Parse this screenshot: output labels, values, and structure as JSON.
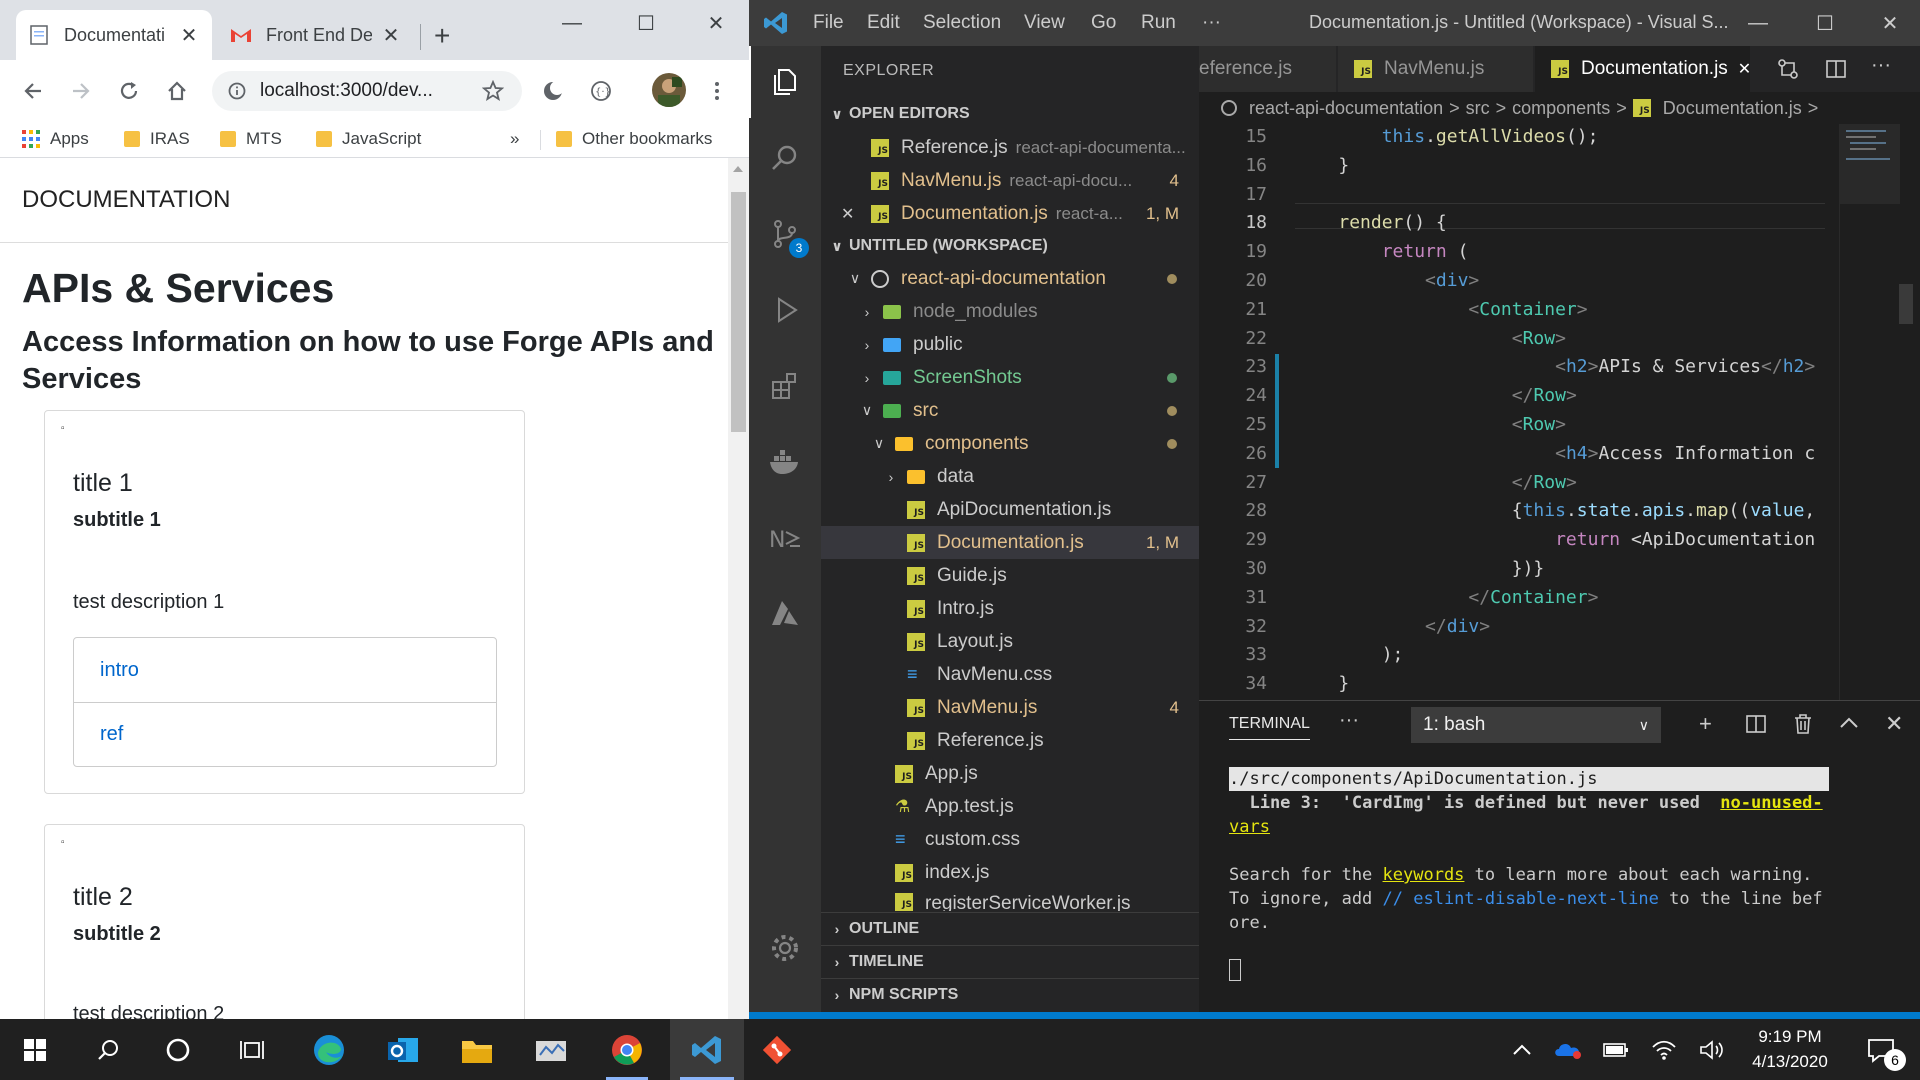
{
  "chrome": {
    "tabs": [
      {
        "title": "Documentati",
        "active": true
      },
      {
        "title": "Front End De",
        "active": false
      }
    ],
    "url": "localhost:3000/dev...",
    "bookmarks": [
      "Apps",
      "IRAS",
      "MTS",
      "JavaScript"
    ],
    "other_bookmarks": "Other bookmarks",
    "overflow": "»"
  },
  "page": {
    "navbar_title": "DOCUMENTATION",
    "heading": "APIs & Services",
    "subheading": "Access Information on how to use Forge APIs and Services",
    "cards": [
      {
        "title": "title 1",
        "subtitle": "subtitle 1",
        "description": "test description 1",
        "links": [
          "intro",
          "ref"
        ]
      },
      {
        "title": "title 2",
        "subtitle": "subtitle 2",
        "description": "test description 2"
      }
    ]
  },
  "vscode": {
    "menu": [
      "File",
      "Edit",
      "Selection",
      "View",
      "Go",
      "Run",
      "···"
    ],
    "window_title": "Documentation.js - Untitled (Workspace) - Visual S...",
    "explorer_title": "EXPLORER",
    "open_editors_title": "OPEN EDITORS",
    "open_editors": [
      {
        "name": "Reference.js",
        "desc": "react-api-documenta...",
        "badge": "",
        "modified": false,
        "close": ""
      },
      {
        "name": "NavMenu.js",
        "desc": "react-api-docu...",
        "badge": "4",
        "modified": true,
        "close": ""
      },
      {
        "name": "Documentation.js",
        "desc": "react-a...",
        "badge": "1, M",
        "modified": true,
        "close": "✕"
      }
    ],
    "workspace_title": "UNTITLED (WORKSPACE)",
    "tree": {
      "root": "react-api-documentation",
      "node_modules": "node_modules",
      "public": "public",
      "screenshots": "ScreenShots",
      "src": "src",
      "components": "components",
      "data": "data",
      "files_components": [
        {
          "name": "ApiDocumentation.js",
          "badge": ""
        },
        {
          "name": "Documentation.js",
          "badge": "1, M"
        },
        {
          "name": "Guide.js",
          "badge": ""
        },
        {
          "name": "Intro.js",
          "badge": ""
        },
        {
          "name": "Layout.js",
          "badge": ""
        },
        {
          "name": "NavMenu.css",
          "badge": ""
        },
        {
          "name": "NavMenu.js",
          "badge": "4"
        },
        {
          "name": "Reference.js",
          "badge": ""
        }
      ],
      "files_src": [
        "App.js",
        "App.test.js",
        "custom.css",
        "index.js",
        "registerServiceWorker.js"
      ]
    },
    "outline": "OUTLINE",
    "timeline": "TIMELINE",
    "npm_scripts": "NPM SCRIPTS",
    "scm_badge": "3",
    "editor_tabs": [
      "eference.js",
      "NavMenu.js",
      "Documentation.js"
    ],
    "breadcrumbs": [
      "react-api-documentation",
      ">",
      "src",
      ">",
      "components",
      ">",
      "Documentation.js",
      ">"
    ],
    "code_lines": [
      {
        "n": "15",
        "text": "        this.getAllVideos();"
      },
      {
        "n": "16",
        "text": "    }"
      },
      {
        "n": "17",
        "text": ""
      },
      {
        "n": "18",
        "text": "    render() {"
      },
      {
        "n": "19",
        "text": "        return ("
      },
      {
        "n": "20",
        "text": "            <div>"
      },
      {
        "n": "21",
        "text": "                <Container>"
      },
      {
        "n": "22",
        "text": "                    <Row>"
      },
      {
        "n": "23",
        "text": "                        <h2>APIs & Services</h2>"
      },
      {
        "n": "24",
        "text": "                    </Row>"
      },
      {
        "n": "25",
        "text": "                    <Row>"
      },
      {
        "n": "26",
        "text": "                        <h4>Access Information c"
      },
      {
        "n": "27",
        "text": "                    </Row>"
      },
      {
        "n": "28",
        "text": "                    {this.state.apis.map((value,"
      },
      {
        "n": "29",
        "text": "                        return <ApiDocumentation"
      },
      {
        "n": "30",
        "text": "                    })}"
      },
      {
        "n": "31",
        "text": "                </Container>"
      },
      {
        "n": "32",
        "text": "            </div>"
      },
      {
        "n": "33",
        "text": "        );"
      },
      {
        "n": "34",
        "text": "    }"
      }
    ],
    "terminal": {
      "tab": "TERMINAL",
      "more": "···",
      "shell": "1: bash",
      "lines": [
        "./src/components/ApiDocumentation.js",
        "  Line 3:  'CardImg' is defined but never used  no-unused-",
        "vars",
        "",
        "Search for the keywords to learn more about each warning.",
        "To ignore, add // eslint-disable-next-line to the line bef",
        "ore."
      ]
    }
  },
  "taskbar": {
    "time": "9:19 PM",
    "date": "4/13/2020",
    "notifications": "6"
  }
}
